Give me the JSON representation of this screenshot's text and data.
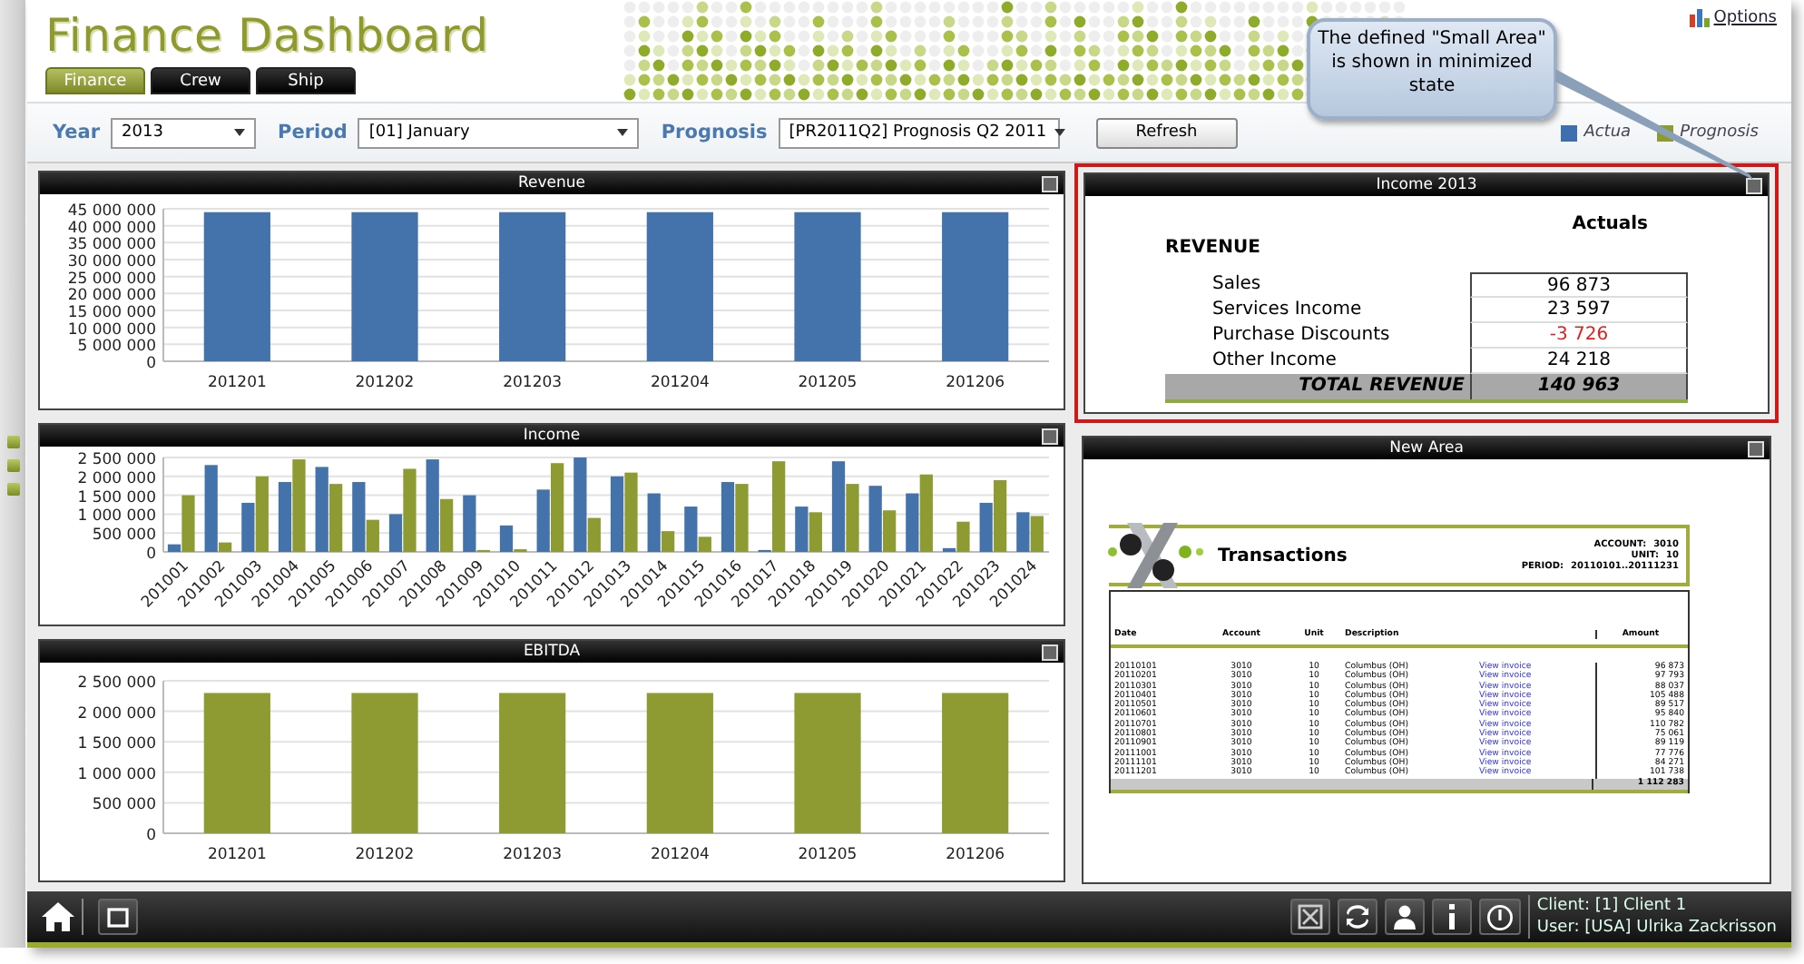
{
  "header": {
    "title": "Finance Dashboard",
    "options_link": "Options"
  },
  "tabs": [
    {
      "label": "Finance",
      "selected": true
    },
    {
      "label": "Crew",
      "selected": false
    },
    {
      "label": "Ship",
      "selected": false
    }
  ],
  "filters": [
    {
      "label": "Year",
      "value": "2013",
      "kind": "short"
    },
    {
      "label": "Period",
      "value": "[01] January",
      "kind": "long"
    },
    {
      "label": "Prognosis",
      "value": "[PR2011Q2] Prognosis Q2 2011",
      "kind": "medium"
    }
  ],
  "refresh_button": "Refresh",
  "legend": [
    {
      "label": "Actua",
      "color": "#3f6fae"
    },
    {
      "label": "Prognosis",
      "color": "#8e9a32"
    }
  ],
  "callout": "The defined \"Small Area\" is shown in minimized state",
  "chart_panels": [
    {
      "title": "Revenue",
      "chart_data": {
        "type": "bar",
        "grid": true,
        "categories": [
          "201201",
          "201202",
          "201203",
          "201204",
          "201205",
          "201206"
        ],
        "ylim": [
          0,
          45000000
        ],
        "yticks": [
          {
            "value": 0,
            "label": "0"
          },
          {
            "value": 5000000,
            "label": "5 000 000"
          },
          {
            "value": 10000000,
            "label": "10 000 000"
          },
          {
            "value": 15000000,
            "label": "15 000 000"
          },
          {
            "value": 20000000,
            "label": "20 000 000"
          },
          {
            "value": 25000000,
            "label": "25 000 000"
          },
          {
            "value": 30000000,
            "label": "30 000 000"
          },
          {
            "value": 35000000,
            "label": "35 000 000"
          },
          {
            "value": 40000000,
            "label": "40 000 000"
          },
          {
            "value": 45000000,
            "label": "45 000 000"
          }
        ],
        "series": [
          {
            "color": "#4472aa",
            "values": [
              44000000,
              44000000,
              44000000,
              44000000,
              44000000,
              44000000
            ]
          }
        ]
      }
    },
    {
      "title": "Income",
      "chart_data": {
        "type": "bar",
        "grid": true,
        "categories": [
          "201001",
          "201002",
          "201003",
          "201004",
          "201005",
          "201006",
          "201007",
          "201008",
          "201009",
          "201010",
          "201011",
          "201012",
          "201013",
          "201014",
          "201015",
          "201016",
          "201017",
          "201018",
          "201019",
          "201020",
          "201021",
          "201022",
          "201023",
          "201024"
        ],
        "ylim": [
          0,
          2500000
        ],
        "yticks": [
          {
            "value": 0,
            "label": "0"
          },
          {
            "value": 500000,
            "label": "500 000"
          },
          {
            "value": 1000000,
            "label": "1 000 000"
          },
          {
            "value": 1500000,
            "label": "1 500 000"
          },
          {
            "value": 2000000,
            "label": "2 000 000"
          },
          {
            "value": 2500000,
            "label": "2 500 000"
          }
        ],
        "series": [
          {
            "color": "#4472aa",
            "values": [
              200000,
              2300000,
              1300000,
              1850000,
              2250000,
              1850000,
              1000000,
              2450000,
              1500000,
              700000,
              1650000,
              2500000,
              2000000,
              1550000,
              1200000,
              1850000,
              50000,
              1200000,
              2400000,
              1750000,
              1550000,
              100000,
              1300000,
              1050000
            ]
          },
          {
            "color": "#8e9a32",
            "values": [
              1500000,
              250000,
              2000000,
              2450000,
              1800000,
              850000,
              2200000,
              1400000,
              50000,
              70000,
              2350000,
              900000,
              2100000,
              550000,
              400000,
              1800000,
              2400000,
              1050000,
              1800000,
              1100000,
              2050000,
              800000,
              1900000,
              950000
            ]
          }
        ]
      }
    },
    {
      "title": "EBITDA",
      "chart_data": {
        "type": "bar",
        "grid": true,
        "categories": [
          "201201",
          "201202",
          "201203",
          "201204",
          "201205",
          "201206"
        ],
        "ylim": [
          0,
          2500000
        ],
        "yticks": [
          {
            "value": 0,
            "label": "0"
          },
          {
            "value": 500000,
            "label": "500 000"
          },
          {
            "value": 1000000,
            "label": "1 000 000"
          },
          {
            "value": 1500000,
            "label": "1 500 000"
          },
          {
            "value": 2000000,
            "label": "2 000 000"
          },
          {
            "value": 2500000,
            "label": "2 500 000"
          }
        ],
        "series": [
          {
            "color": "#8e9a32",
            "values": [
              2300000,
              2300000,
              2300000,
              2300000,
              2300000,
              2300000
            ]
          }
        ]
      }
    }
  ],
  "income_panel": {
    "title": "Income 2013",
    "column": "Actuals",
    "section": "REVENUE",
    "rows": [
      {
        "label": "Sales",
        "value": "96 873",
        "negative": false
      },
      {
        "label": "Services Income",
        "value": "23 597",
        "negative": false
      },
      {
        "label": "Purchase Discounts",
        "value": "-3 726",
        "negative": true
      },
      {
        "label": "Other Income",
        "value": "24 218",
        "negative": false
      }
    ],
    "total": {
      "label": "TOTAL REVENUE",
      "value": "140 963"
    }
  },
  "new_area": {
    "title": "New Area",
    "report": {
      "title": "Transactions",
      "meta": [
        {
          "label": "ACCOUNT:",
          "value": "3010"
        },
        {
          "label": "UNIT:",
          "value": "10"
        },
        {
          "label": "PERIOD:",
          "value": "20110101..20111231"
        }
      ],
      "columns": [
        "Date",
        "Account",
        "Unit",
        "Description",
        "Amount"
      ],
      "rows": [
        {
          "date": "20110101",
          "account": "3010",
          "unit": "10",
          "description": "Columbus (OH)",
          "link": "View invoice",
          "amount": "96 873"
        },
        {
          "date": "20110201",
          "account": "3010",
          "unit": "10",
          "description": "Columbus (OH)",
          "link": "View invoice",
          "amount": "97 793"
        },
        {
          "date": "20110301",
          "account": "3010",
          "unit": "10",
          "description": "Columbus (OH)",
          "link": "View invoice",
          "amount": "88 037"
        },
        {
          "date": "20110401",
          "account": "3010",
          "unit": "10",
          "description": "Columbus (OH)",
          "link": "View invoice",
          "amount": "105 488"
        },
        {
          "date": "20110501",
          "account": "3010",
          "unit": "10",
          "description": "Columbus (OH)",
          "link": "View invoice",
          "amount": "89 517"
        },
        {
          "date": "20110601",
          "account": "3010",
          "unit": "10",
          "description": "Columbus (OH)",
          "link": "View invoice",
          "amount": "95 840"
        },
        {
          "date": "20110701",
          "account": "3010",
          "unit": "10",
          "description": "Columbus (OH)",
          "link": "View invoice",
          "amount": "110 782"
        },
        {
          "date": "20110801",
          "account": "3010",
          "unit": "10",
          "description": "Columbus (OH)",
          "link": "View invoice",
          "amount": "75 061"
        },
        {
          "date": "20110901",
          "account": "3010",
          "unit": "10",
          "description": "Columbus (OH)",
          "link": "View invoice",
          "amount": "89 119"
        },
        {
          "date": "20111001",
          "account": "3010",
          "unit": "10",
          "description": "Columbus (OH)",
          "link": "View invoice",
          "amount": "77 776"
        },
        {
          "date": "20111101",
          "account": "3010",
          "unit": "10",
          "description": "Columbus (OH)",
          "link": "View invoice",
          "amount": "84 271"
        },
        {
          "date": "20111201",
          "account": "3010",
          "unit": "10",
          "description": "Columbus (OH)",
          "link": "View invoice",
          "amount": "101 738"
        }
      ],
      "total": "1 112 283"
    }
  },
  "status": {
    "client": "Client: [1] Client 1",
    "user": "User: [USA] Ulrika Zackrisson"
  }
}
